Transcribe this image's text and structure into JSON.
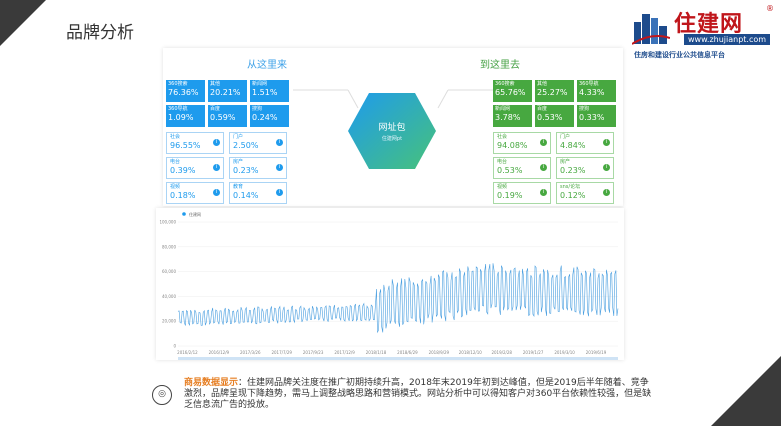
{
  "page_title": "品牌分析",
  "logo": {
    "name": "住建网",
    "url": "www.zhujianpt.com",
    "tagline": "住房和建设行业公共信息平台",
    "reg": "®",
    "colors": {
      "red": "#c0161b",
      "blue": "#1d4b8c"
    }
  },
  "from_section": {
    "title": "从这里来",
    "tiles": [
      {
        "label": "360搜索",
        "value": "76.36%"
      },
      {
        "label": "其他",
        "value": "20.21%"
      },
      {
        "label": "新闻网",
        "value": "1.51%"
      },
      {
        "label": "360导航",
        "value": "1.09%"
      },
      {
        "label": "百度",
        "value": "0.59%"
      },
      {
        "label": "搜狗",
        "value": "0.24%"
      }
    ],
    "boxes": [
      {
        "label": "社会",
        "value": "96.55%"
      },
      {
        "label": "门户",
        "value": "2.50%"
      },
      {
        "label": "电台",
        "value": "0.39%"
      },
      {
        "label": "房产",
        "value": "0.23%"
      },
      {
        "label": "视频",
        "value": "0.18%"
      },
      {
        "label": "教育",
        "value": "0.14%"
      }
    ]
  },
  "to_section": {
    "title": "到这里去",
    "tiles": [
      {
        "label": "360搜索",
        "value": "65.76%"
      },
      {
        "label": "其他",
        "value": "25.27%"
      },
      {
        "label": "360导航",
        "value": "4.33%"
      },
      {
        "label": "新闻网",
        "value": "3.78%"
      },
      {
        "label": "百度",
        "value": "0.53%"
      },
      {
        "label": "搜狗",
        "value": "0.33%"
      }
    ],
    "boxes": [
      {
        "label": "社会",
        "value": "94.08%"
      },
      {
        "label": "门户",
        "value": "4.84%"
      },
      {
        "label": "电台",
        "value": "0.53%"
      },
      {
        "label": "房产",
        "value": "0.23%"
      },
      {
        "label": "视频",
        "value": "0.19%"
      },
      {
        "label": "sns/论坛",
        "value": "0.12%"
      }
    ]
  },
  "center": {
    "title": "网址包",
    "subtitle": "住建网pt"
  },
  "chart_data": {
    "type": "line",
    "legend": "住建网",
    "y_ticks": [
      "0",
      "20,000",
      "40,000",
      "60,000",
      "80,000",
      "100,000"
    ],
    "ylim": [
      0,
      100000
    ],
    "x_ticks": [
      "2016/2/12",
      "2016/12/9",
      "2017/3/26",
      "2017/7/29",
      "2017/9/23",
      "2017/12/9",
      "2018/1/18",
      "2018/6/29",
      "2018/9/29",
      "2018/12/10",
      "2019/2/28",
      "2019/1/27",
      "2019/3/10",
      "2019/6/19"
    ]
  },
  "summary": {
    "head": "商易数据显示",
    "text": "：住建网品牌关注度在推广初期持续升高，2018年末2019年初到达峰值，但是2019后半年随着、竞争激烈，品牌呈现下降趋势，需马上调整战略思路和营销模式。网站分析中可以得知客户对360平台依赖性较强，但是缺乏信息流广告的投放。"
  },
  "colors": {
    "blue": "#1e9bed",
    "green": "#47a840",
    "dark": "#3a3a3a",
    "accent": "#e67e22"
  }
}
